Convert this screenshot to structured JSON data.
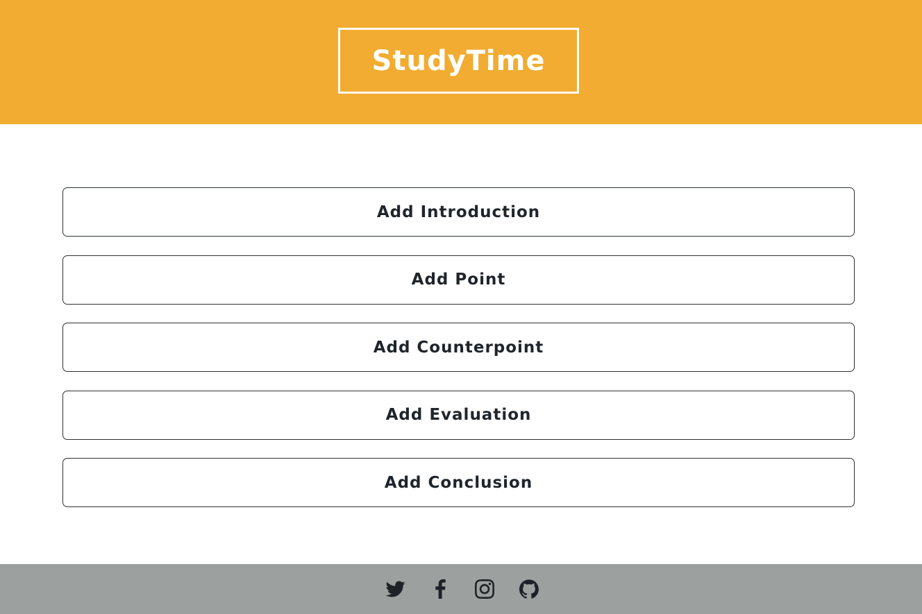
{
  "header": {
    "logo_text": "StudyTime",
    "background_color": "#f1ac31"
  },
  "actions": [
    {
      "label": "Add Introduction"
    },
    {
      "label": "Add Point"
    },
    {
      "label": "Add Counterpoint"
    },
    {
      "label": "Add Evaluation"
    },
    {
      "label": "Add Conclusion"
    }
  ],
  "footer": {
    "background_color": "#9ca09e",
    "social_icons": [
      "twitter-icon",
      "facebook-icon",
      "instagram-icon",
      "github-icon"
    ]
  }
}
